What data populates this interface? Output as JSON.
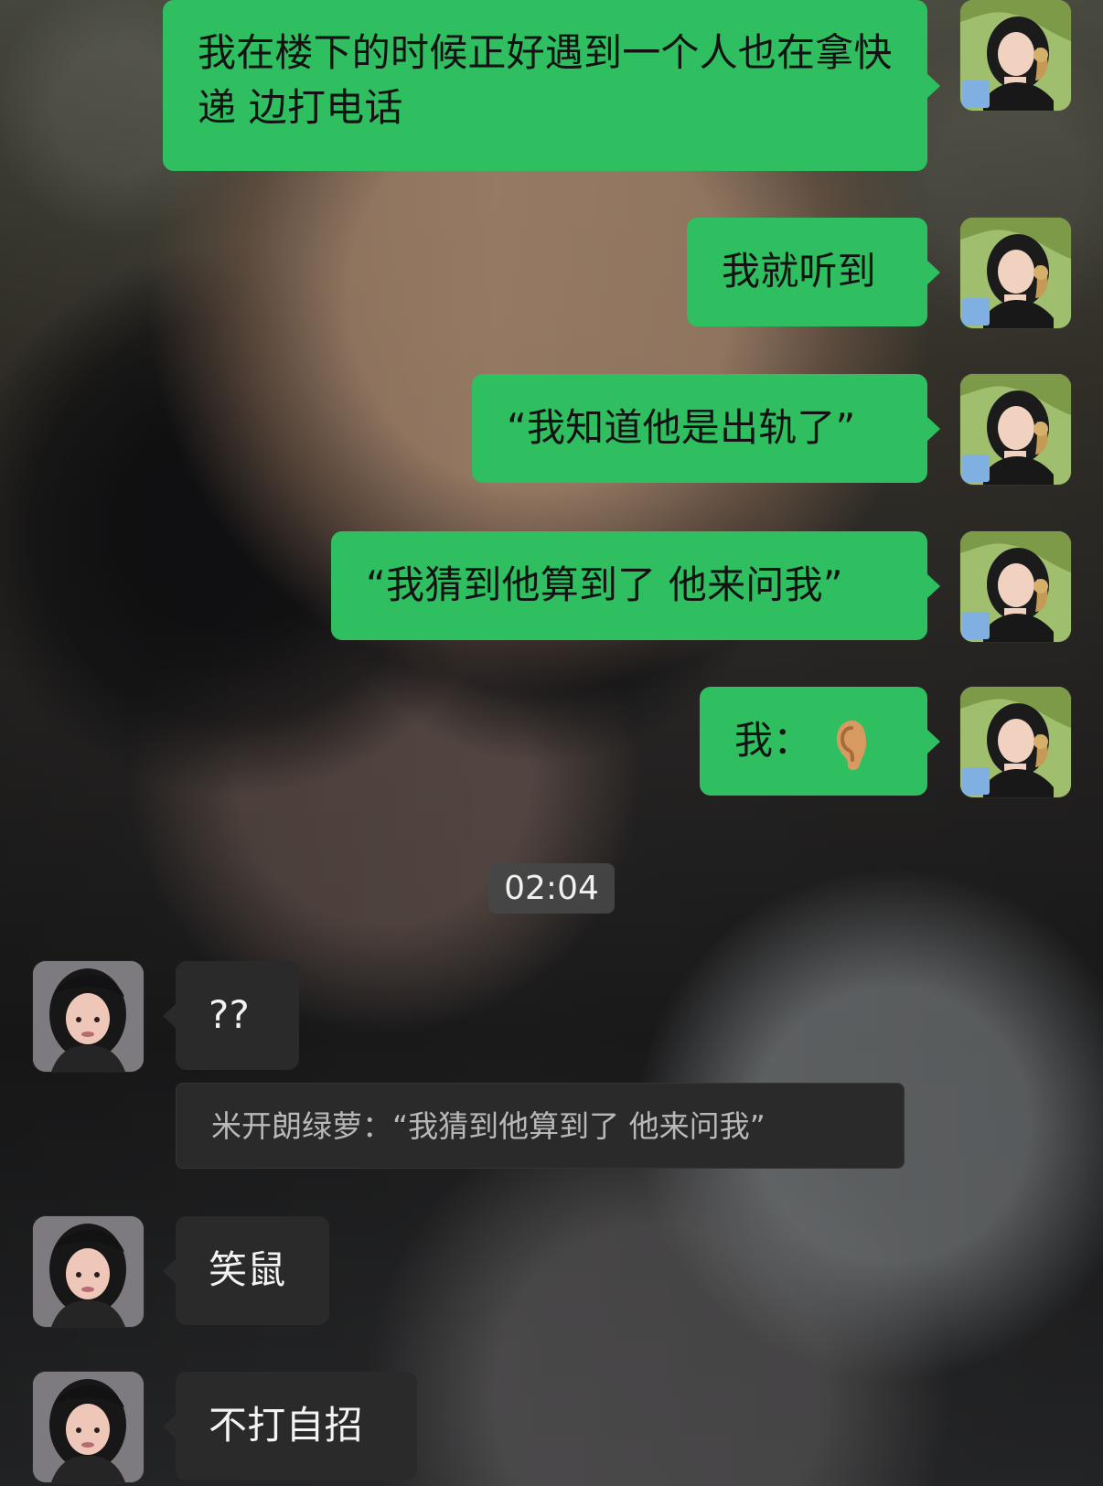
{
  "messages": [
    {
      "text": "我在楼下的时候正好遇到一个人也在拿快递 边打电话"
    },
    {
      "text": "我就听到"
    },
    {
      "text": "“我知道他是出轨了”"
    },
    {
      "text": "“我猜到他算到了 他来问我”"
    },
    {
      "text": "我："
    },
    {
      "timestamp": "02:04"
    },
    {
      "text": "??"
    },
    {
      "quote": "米开朗绿萝：“我猜到他算到了 他来问我”"
    },
    {
      "text": "笑鼠"
    },
    {
      "text": "不打自招"
    }
  ],
  "icons": {
    "ear": "ear-icon"
  },
  "colors": {
    "sent_bubble": "#2fbe60",
    "received_bubble": "#2a2a2a",
    "quote_text": "#b8b8b8"
  }
}
